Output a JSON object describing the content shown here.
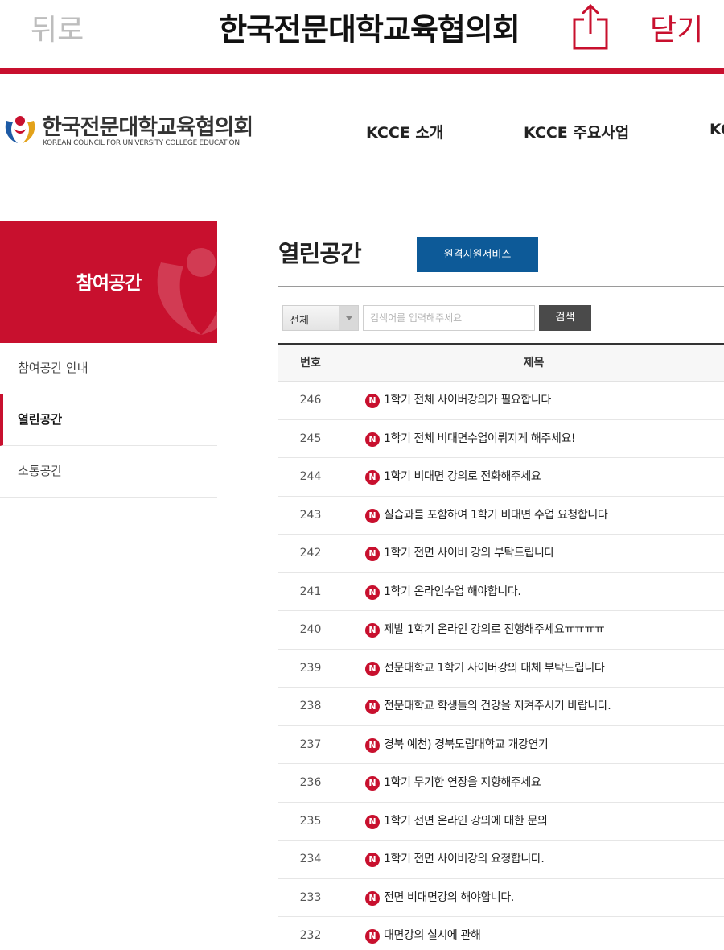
{
  "browser": {
    "back_label": "뒤로",
    "title": "한국전문대학교육협의회",
    "close_label": "닫기"
  },
  "site": {
    "logo_ko": "한국전문대학교육협의회",
    "logo_en": "KOREAN COUNCIL FOR UNIVERSITY COLLEGE EDUCATION",
    "nav": [
      "KCCE 소개",
      "KCCE 주요사업",
      "KC"
    ]
  },
  "sidebar": {
    "heading": "참여공간",
    "items": [
      {
        "label": "참여공간 안내"
      },
      {
        "label": "열린공간"
      },
      {
        "label": "소통공간"
      }
    ]
  },
  "content": {
    "title": "열린공간",
    "remote_button": "원격지원서비스",
    "search": {
      "select_value": "전체",
      "placeholder": "검색어를 입력해주세요",
      "button": "검색"
    },
    "table": {
      "col_no": "번호",
      "col_title": "제목",
      "badge": "N",
      "rows": [
        {
          "no": "246",
          "title": "1학기 전체 사이버강의가 필요합니다"
        },
        {
          "no": "245",
          "title": "1학기 전체 비대면수업이뤄지게 해주세요!"
        },
        {
          "no": "244",
          "title": "1학기 비대면 강의로 전화해주세요"
        },
        {
          "no": "243",
          "title": "실습과를 포함하여 1학기 비대면 수업 요청합니다"
        },
        {
          "no": "242",
          "title": "1학기 전면 사이버 강의 부탁드립니다"
        },
        {
          "no": "241",
          "title": "1학기 온라인수업 해야합니다."
        },
        {
          "no": "240",
          "title": "제발 1학기 온라인 강의로 진행해주세요ㅠㅠㅠㅠ"
        },
        {
          "no": "239",
          "title": "전문대학교 1학기 사이버강의 대체 부탁드립니다"
        },
        {
          "no": "238",
          "title": "전문대학교 학생들의 건강을 지켜주시기 바랍니다."
        },
        {
          "no": "237",
          "title": "경북 예천) 경북도립대학교 개강연기"
        },
        {
          "no": "236",
          "title": "1학기 무기한 연장을 지향해주세요"
        },
        {
          "no": "235",
          "title": "1학기 전면 온라인 강의에 대한 문의"
        },
        {
          "no": "234",
          "title": "1학기 전면 사이버강의 요청합니다."
        },
        {
          "no": "233",
          "title": "전면 비대면강의 해야합니다."
        },
        {
          "no": "232",
          "title": "대면강의 실시에 관해"
        }
      ]
    }
  },
  "colors": {
    "brand_red": "#c8102e",
    "button_blue": "#0d5a98",
    "search_button": "#4a4a4a"
  }
}
